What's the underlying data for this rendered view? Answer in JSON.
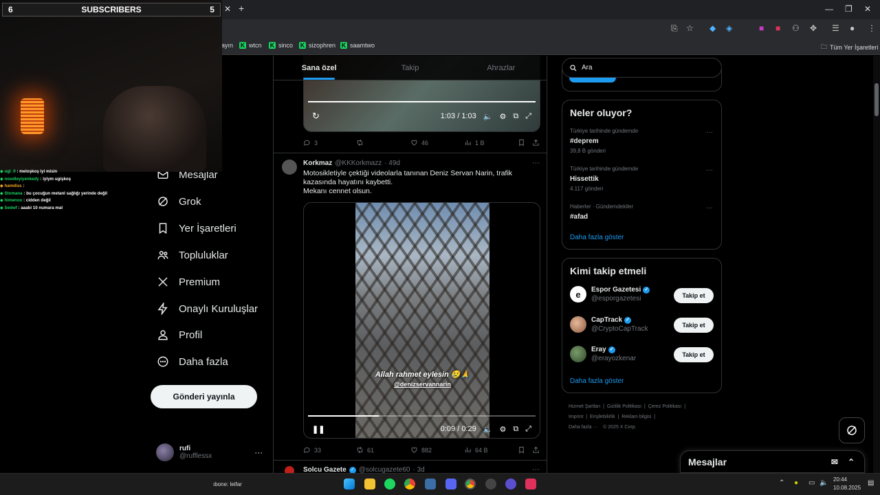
{
  "overlay": {
    "subs_left": "6",
    "subs_label": "SUBSCRIBERS",
    "subs_right": "5",
    "chat": [
      {
        "user": "ugi_0",
        "msg": "meloşkoş iyi misin"
      },
      {
        "user": "noodleyiyenkedy",
        "msg": "iyiym ugişkoş"
      },
      {
        "user": "hamdiss",
        "msg": ""
      },
      {
        "user": "Stomana",
        "msg": "bu çocuğun metanl sağlığı yerinde değil"
      },
      {
        "user": "himenoo",
        "msg": "cidden değil"
      },
      {
        "user": "Sedwf",
        "msg": "aaabi 10 numara mal"
      }
    ]
  },
  "browser": {
    "bookmarks": [
      "ayın",
      "wtcn",
      "sinco",
      "sizophren",
      "saamtwo"
    ],
    "all_bookmarks": "Tüm Yer İşaretleri"
  },
  "nav": {
    "items": [
      "Mesajlar",
      "Grok",
      "Yer İşaretleri",
      "Topluluklar",
      "Premium",
      "Onaylı Kuruluşlar",
      "Profil",
      "Daha fazla"
    ],
    "post_button": "Gönderi yayınla",
    "account_name": "rufi",
    "account_handle": "@rufflessx"
  },
  "timeline": {
    "tabs": [
      "Sana özel",
      "Takip",
      "Ahrazlar"
    ],
    "video1_time": "1:03 / 1:03",
    "video1_progress": 1.0,
    "tweet0_stats": {
      "replies": "3",
      "likes": "46",
      "views": "1 B"
    },
    "tweet1": {
      "name": "Korkmaz",
      "handle": "@KKKorkmazz",
      "time": "· 49d",
      "text1": "Motosikletiyle çektiği videolarla tanınan Deniz Servan Narin, trafik",
      "text2": "kazasında hayatını kaybetti.",
      "text3": "Mekanı cennet olsun.",
      "overlay_line1": "Allah rahmet eylesin 😢🙏",
      "overlay_line2": "@denizservannarin",
      "video_time": "0:09 / 0:29",
      "video_progress": 0.31,
      "replies": "33",
      "retweets": "61",
      "likes": "882",
      "views": "64 B"
    },
    "tweet2": {
      "name": "Solcu Gazete",
      "handle": "@solcugazete60",
      "time": "· 3d"
    }
  },
  "sidebar": {
    "search_placeholder": "Ara",
    "trends_title": "Neler oluyor?",
    "trends": [
      {
        "context": "Türkiye tarihinde gündemde",
        "name": "#deprem",
        "count": "39,8 B gönderi"
      },
      {
        "context": "Türkiye tarihinde gündemde",
        "name": "Hissettik",
        "count": "4.117 gönderi"
      },
      {
        "context": "Haberler · Gündemdekiler",
        "name": "#afad",
        "count": ""
      }
    ],
    "trends_more": "Daha fazla göster",
    "follow_title": "Kimi takip etmeli",
    "follow": [
      {
        "name": "Espor Gazetesi",
        "handle": "@esporgazetesi",
        "button": "Takip et"
      },
      {
        "name": "CapTrack",
        "handle": "@CryptoCapTrack",
        "button": "Takip et"
      },
      {
        "name": "Eray",
        "handle": "@erayozkenar",
        "button": "Takip et"
      }
    ],
    "follow_more": "Daha fazla göster",
    "footer": [
      "Hizmet Şartları",
      "Gizlilik Politikası",
      "Çerez Politikası",
      "Imprint",
      "Erişilebilirlik",
      "Reklam bilgisi",
      "Daha fazla ···",
      "© 2025 X Corp."
    ]
  },
  "drawer": {
    "title": "Mesajlar"
  },
  "taskbar": {
    "left_text": "ıbone: leifar",
    "time": "20:44",
    "date": "10.08.2025"
  }
}
